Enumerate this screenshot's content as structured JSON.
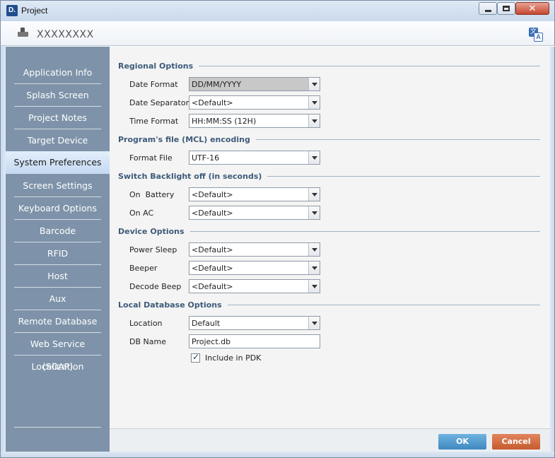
{
  "window": {
    "title": "Project",
    "logo_text": "D."
  },
  "header": {
    "project_name": "XXXXXXXX"
  },
  "sidebar": {
    "items": [
      {
        "label": "Application Info"
      },
      {
        "label": "Splash Screen"
      },
      {
        "label": "Project Notes"
      },
      {
        "label": "Target Device"
      },
      {
        "label": "System Preferences",
        "active": true
      },
      {
        "label": "Screen Settings"
      },
      {
        "label": "Keyboard Options"
      },
      {
        "label": "Barcode"
      },
      {
        "label": "RFID"
      },
      {
        "label": "Host"
      },
      {
        "label": "Aux"
      },
      {
        "label": "Remote Database"
      },
      {
        "label": "Web Service (SOAP)"
      },
      {
        "label": "Localization"
      }
    ]
  },
  "sections": {
    "regional": {
      "title": "Regional Options",
      "date_format": {
        "label": "Date Format",
        "value": "DD/MM/YYYY"
      },
      "date_separator": {
        "label": "Date Separator",
        "value": "<Default>"
      },
      "time_format": {
        "label": "Time Format",
        "value": "HH:MM:SS (12H)"
      }
    },
    "mcl": {
      "title": "Program's file (MCL) encoding",
      "format_file": {
        "label": "Format File",
        "value": "UTF-16"
      }
    },
    "backlight": {
      "title": "Switch Backlight off (in seconds)",
      "on_battery": {
        "label": "On  Battery",
        "value": "<Default>"
      },
      "on_ac": {
        "label": "On AC",
        "value": "<Default>"
      }
    },
    "device": {
      "title": "Device Options",
      "power_sleep": {
        "label": "Power Sleep",
        "value": "<Default>"
      },
      "beeper": {
        "label": "Beeper",
        "value": "<Default>"
      },
      "decode_beep": {
        "label": "Decode Beep",
        "value": "<Default>"
      }
    },
    "localdb": {
      "title": "Local Database Options",
      "location": {
        "label": "Location",
        "value": "Default"
      },
      "db_name": {
        "label": "DB Name",
        "value": "Project.db"
      },
      "include_pdk": {
        "label": "Include in PDK",
        "checked": true
      }
    }
  },
  "footer": {
    "ok_label": "OK",
    "cancel_label": "Cancel"
  },
  "translate_icon": {
    "glyph_top": "文",
    "glyph_bottom": "A"
  },
  "colors": {
    "sidebar": "#7e93a9",
    "section_title": "#3e5b7a",
    "ok": "#4a93c9",
    "cancel": "#d06a3e"
  }
}
